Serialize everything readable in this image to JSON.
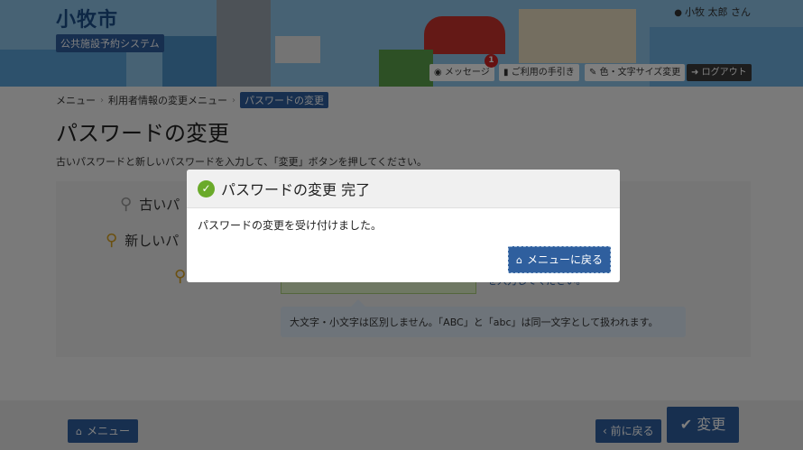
{
  "header": {
    "site_title": "小牧市",
    "site_subtitle": "公共施設予約システム",
    "user_name": "小牧 太郎 さん",
    "message_label": "メッセージ",
    "message_count": "1",
    "guide_label": "ご利用の手引き",
    "color_label": "色・文字サイズ変更",
    "logout_label": "ログアウト"
  },
  "breadcrumb": {
    "items": [
      "メニュー",
      "利用者情報の変更メニュー",
      "パスワードの変更"
    ]
  },
  "page": {
    "title": "パスワードの変更",
    "instruction": "古いパスワードと新しいパスワードを入力して、「変更」ボタンを押してください。"
  },
  "form": {
    "old_password_label": "古いパ",
    "new_password_label": "新しいパ",
    "confirm_label": "",
    "ok_tag": "",
    "right_hint": "を入力してください。",
    "note": "大文字・小文字は区別しません。「ABC」と「abc」は同一文字として扱われます。"
  },
  "footer": {
    "menu_label": "メニュー",
    "back_label": "前に戻る",
    "change_label": "変更"
  },
  "modal": {
    "title": "パスワードの変更 完了",
    "body": "パスワードの変更を受け付けました。",
    "button_label": "メニューに戻る"
  },
  "colors": {
    "primary": "#2f5f9e",
    "success": "#6aaa2a",
    "badge": "#cc2222"
  }
}
